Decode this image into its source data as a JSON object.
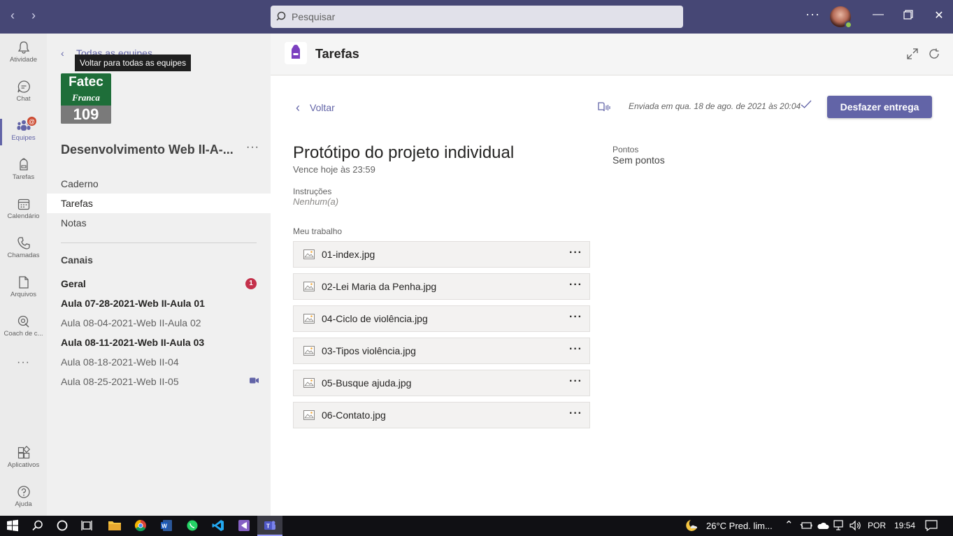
{
  "titlebar": {
    "search_placeholder": "Pesquisar",
    "more": "···"
  },
  "rail": {
    "items": [
      {
        "label": "Atividade",
        "icon": "bell-icon"
      },
      {
        "label": "Chat",
        "icon": "chat-icon"
      },
      {
        "label": "Equipes",
        "icon": "teams-icon",
        "active": true,
        "badge": "@"
      },
      {
        "label": "Tarefas",
        "icon": "backpack-icon"
      },
      {
        "label": "Calendário",
        "icon": "calendar-icon"
      },
      {
        "label": "Chamadas",
        "icon": "phone-icon"
      },
      {
        "label": "Arquivos",
        "icon": "file-icon"
      },
      {
        "label": "Coach de c...",
        "icon": "coach-icon"
      }
    ],
    "more": "···",
    "bottom": [
      {
        "label": "Aplicativos",
        "icon": "apps-icon"
      },
      {
        "label": "Ajuda",
        "icon": "help-icon"
      }
    ]
  },
  "team": {
    "back_link": "Todas as equipes",
    "tooltip": "Voltar para todas as equipes",
    "logo": {
      "line1": "Fatec",
      "line2": "Franca",
      "line3": "109"
    },
    "name": "Desenvolvimento Web II-A-...",
    "more": "···",
    "tabs": [
      "Caderno",
      "Tarefas",
      "Notas"
    ],
    "active_tab": "Tarefas",
    "channels_header": "Canais",
    "channels": [
      {
        "name": "Geral",
        "bold": true,
        "badge": "1"
      },
      {
        "name": "Aula 07-28-2021-Web II-Aula 01",
        "bold": true
      },
      {
        "name": "Aula 08-04-2021-Web II-Aula 02",
        "bold": false
      },
      {
        "name": "Aula 08-11-2021-Web II-Aula 03",
        "bold": true
      },
      {
        "name": "Aula 08-18-2021-Web II-04",
        "bold": false
      },
      {
        "name": "Aula 08-25-2021-Web II-05",
        "bold": false,
        "icon": "video-icon"
      }
    ]
  },
  "header": {
    "app_title": "Tarefas"
  },
  "assignment": {
    "back": "Voltar",
    "sent_status": "Enviada em qua. 18 de ago. de 2021 às 20:04",
    "undo_button": "Desfazer entrega",
    "title": "Protótipo do projeto individual",
    "due": "Vence hoje às 23:59",
    "points_label": "Pontos",
    "points_value": "Sem pontos",
    "instructions_label": "Instruções",
    "instructions_value": "Nenhum(a)",
    "work_label": "Meu trabalho",
    "files": [
      "01-index.jpg",
      "02-Lei Maria da Penha.jpg",
      "04-Ciclo de violência.jpg",
      "03-Tipos violência.jpg",
      "05-Busque ajuda.jpg",
      "06-Contato.jpg"
    ],
    "file_more": "···"
  },
  "taskbar": {
    "weather": "26°C  Pred. lim...",
    "lang": "POR",
    "time": "19:54"
  },
  "colors": {
    "accent": "#6264a7",
    "titlebar": "#464775",
    "badge": "#c4314b"
  }
}
